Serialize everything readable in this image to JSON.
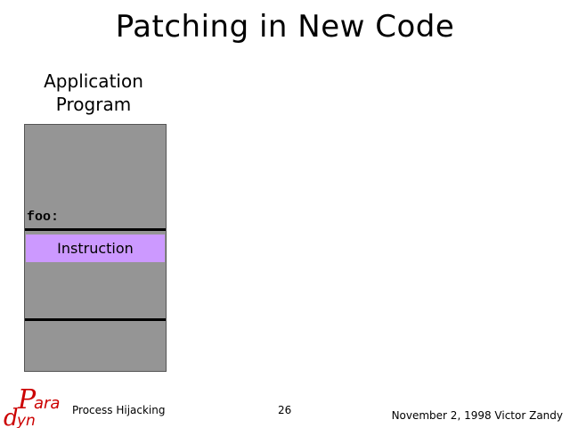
{
  "slide": {
    "title": "Patching in New Code"
  },
  "diagram": {
    "app_label_line1": "Application",
    "app_label_line2": "Program",
    "code_label": "foo:",
    "instruction_label": "Instruction",
    "colors": {
      "program_fill": "#959595",
      "instruction_fill": "#cc99ff",
      "divider": "#000000"
    }
  },
  "footer": {
    "logo_text_top": "Para",
    "logo_text_bottom": "dyn",
    "logo_color": "#cc0000",
    "left_text": "Process Hijacking",
    "page_number": "26",
    "right_text": "November 2, 1998  Victor Zandy"
  }
}
